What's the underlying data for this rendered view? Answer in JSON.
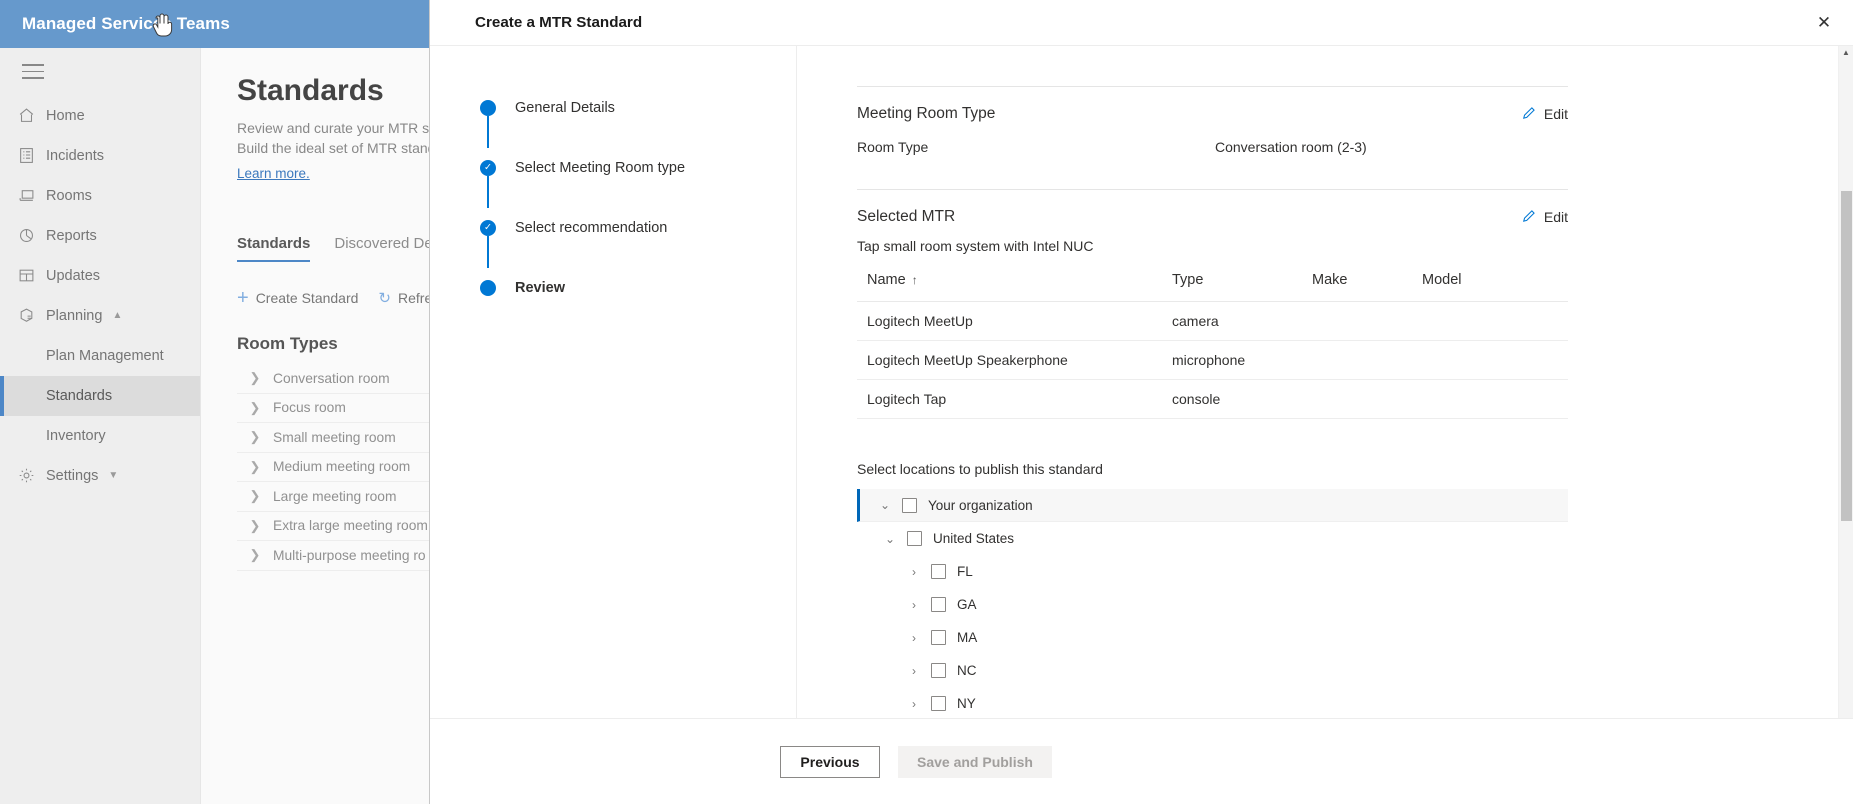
{
  "app": {
    "topbar_title": "Managed Services Teams"
  },
  "sidebar": {
    "items": [
      {
        "label": "Home",
        "icon": "home-icon"
      },
      {
        "label": "Incidents",
        "icon": "incidents-icon"
      },
      {
        "label": "Rooms",
        "icon": "rooms-icon"
      },
      {
        "label": "Reports",
        "icon": "reports-icon"
      },
      {
        "label": "Updates",
        "icon": "updates-icon"
      },
      {
        "label": "Planning",
        "icon": "planning-icon"
      },
      {
        "label": "Plan Management",
        "icon": ""
      },
      {
        "label": "Standards",
        "icon": ""
      },
      {
        "label": "Inventory",
        "icon": ""
      },
      {
        "label": "Settings",
        "icon": "settings-icon"
      }
    ]
  },
  "page": {
    "title": "Standards",
    "subtitle_line1": "Review and curate your MTR sta",
    "subtitle_line2": "Build the ideal set of MTR stand",
    "learn_more": "Learn more.",
    "tabs": [
      {
        "label": "Standards"
      },
      {
        "label": "Discovered Dev"
      }
    ],
    "commands": {
      "create_standard": "Create Standard",
      "refresh": "Refre"
    },
    "room_types_title": "Room Types",
    "room_types": [
      "Conversation room",
      "Focus room",
      "Small meeting room",
      "Medium meeting room",
      "Large meeting room",
      "Extra large meeting room",
      "Multi-purpose meeting ro"
    ]
  },
  "modal": {
    "title": "Create a MTR Standard",
    "close_icon": "close-icon",
    "steps": [
      {
        "label": "General Details",
        "state": "done-plain"
      },
      {
        "label": "Select Meeting Room type",
        "state": "complete"
      },
      {
        "label": "Select recommendation",
        "state": "complete"
      },
      {
        "label": "Review",
        "state": "current"
      }
    ],
    "meeting_room_type": {
      "section_title": "Meeting Room Type",
      "edit_label": "Edit",
      "key": "Room Type",
      "value": "Conversation room (2-3)"
    },
    "selected_mtr": {
      "section_title": "Selected MTR",
      "edit_label": "Edit",
      "subtitle": "Tap small room system with Intel NUC",
      "columns": [
        "Name",
        "Type",
        "Make",
        "Model"
      ],
      "sort_column": "Name",
      "sort_arrow": "↑",
      "rows": [
        {
          "name": "Logitech MeetUp",
          "type": "camera",
          "make": "",
          "model": ""
        },
        {
          "name": "Logitech MeetUp Speakerphone",
          "type": "microphone",
          "make": "",
          "model": ""
        },
        {
          "name": "Logitech Tap",
          "type": "console",
          "make": "",
          "model": ""
        }
      ]
    },
    "locations": {
      "heading": "Select locations to publish this standard",
      "tree": [
        {
          "label": "Your organization",
          "depth": 0,
          "expanded": true,
          "checked": false
        },
        {
          "label": "United States",
          "depth": 1,
          "expanded": true,
          "checked": false
        },
        {
          "label": "FL",
          "depth": 2,
          "expanded": false,
          "checked": false
        },
        {
          "label": "GA",
          "depth": 2,
          "expanded": false,
          "checked": false
        },
        {
          "label": "MA",
          "depth": 2,
          "expanded": false,
          "checked": false
        },
        {
          "label": "NC",
          "depth": 2,
          "expanded": false,
          "checked": false
        },
        {
          "label": "NY",
          "depth": 2,
          "expanded": false,
          "checked": false
        }
      ]
    },
    "footer": {
      "previous": "Previous",
      "save_publish": "Save and Publish"
    }
  },
  "colors": {
    "topbar": "#6699cc",
    "accent": "#0078d4",
    "selected_nav": "#dcdcdc",
    "link": "#3b78bd"
  }
}
